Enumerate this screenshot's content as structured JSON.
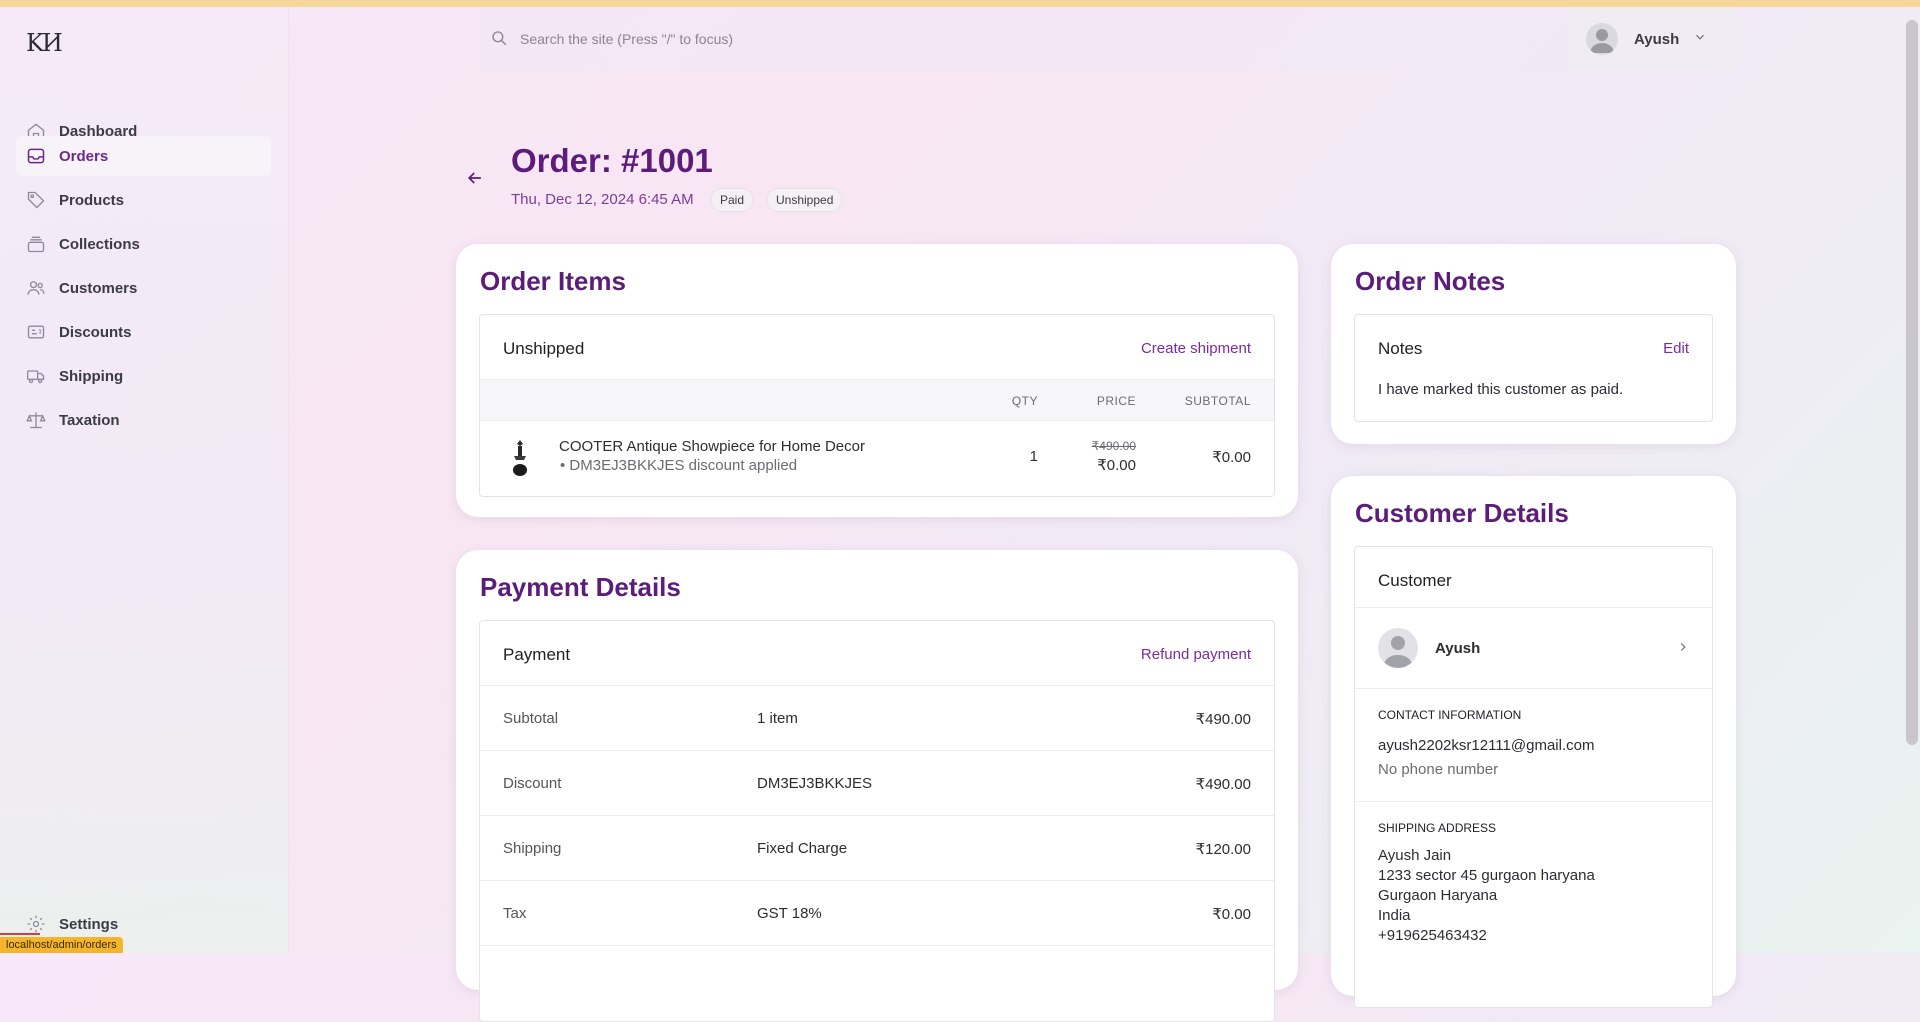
{
  "sidebar": {
    "logo": "KИ",
    "items": [
      {
        "label": "Dashboard",
        "icon": "home-icon"
      },
      {
        "label": "Orders",
        "icon": "inbox-icon",
        "active": true
      },
      {
        "label": "Products",
        "icon": "tag-icon"
      },
      {
        "label": "Collections",
        "icon": "stack-icon"
      },
      {
        "label": "Customers",
        "icon": "users-icon"
      },
      {
        "label": "Discounts",
        "icon": "receipt-icon"
      },
      {
        "label": "Shipping",
        "icon": "truck-icon"
      },
      {
        "label": "Taxation",
        "icon": "scale-icon"
      }
    ],
    "settings_label": "Settings",
    "status_url": "localhost/admin/orders"
  },
  "header": {
    "search_placeholder": "Search the site (Press \"/\" to focus)",
    "user_name": "Ayush"
  },
  "order": {
    "title": "Order: #1001",
    "date": "Thu, Dec 12, 2024 6:45 AM",
    "badges": [
      "Paid",
      "Unshipped"
    ]
  },
  "order_items": {
    "title": "Order Items",
    "status": "Unshipped",
    "action": "Create shipment",
    "columns": [
      "QTY",
      "PRICE",
      "SUBTOTAL"
    ],
    "item": {
      "name": "COOTER Antique Showpiece for Home Decor",
      "discount_note": "DM3EJ3BKKJES discount applied",
      "qty": "1",
      "original_price": "₹490.00",
      "price": "₹0.00",
      "subtotal": "₹0.00"
    }
  },
  "payment": {
    "title": "Payment Details",
    "head": "Payment",
    "action": "Refund payment",
    "rows": [
      {
        "label": "Subtotal",
        "detail": "1 item",
        "amount": "₹490.00"
      },
      {
        "label": "Discount",
        "detail": "DM3EJ3BKKJES",
        "amount": "₹490.00"
      },
      {
        "label": "Shipping",
        "detail": "Fixed Charge",
        "amount": "₹120.00"
      },
      {
        "label": "Tax",
        "detail": "GST 18%",
        "amount": "₹0.00"
      }
    ]
  },
  "notes": {
    "title": "Order Notes",
    "head": "Notes",
    "action": "Edit",
    "text": "I have marked this customer as paid."
  },
  "customer": {
    "title": "Customer Details",
    "head": "Customer",
    "name": "Ayush",
    "contact_label": "CONTACT INFORMATION",
    "email": "ayush2202ksr12111@gmail.com",
    "phone": "No phone number",
    "shipping_label": "SHIPPING ADDRESS",
    "address_lines": [
      "Ayush Jain",
      "1233 sector 45 gurgaon haryana",
      "Gurgaon Haryana",
      "India",
      "+919625463432"
    ]
  },
  "colors": {
    "accent": "#5b1c7a",
    "link": "#7b2aa0"
  }
}
